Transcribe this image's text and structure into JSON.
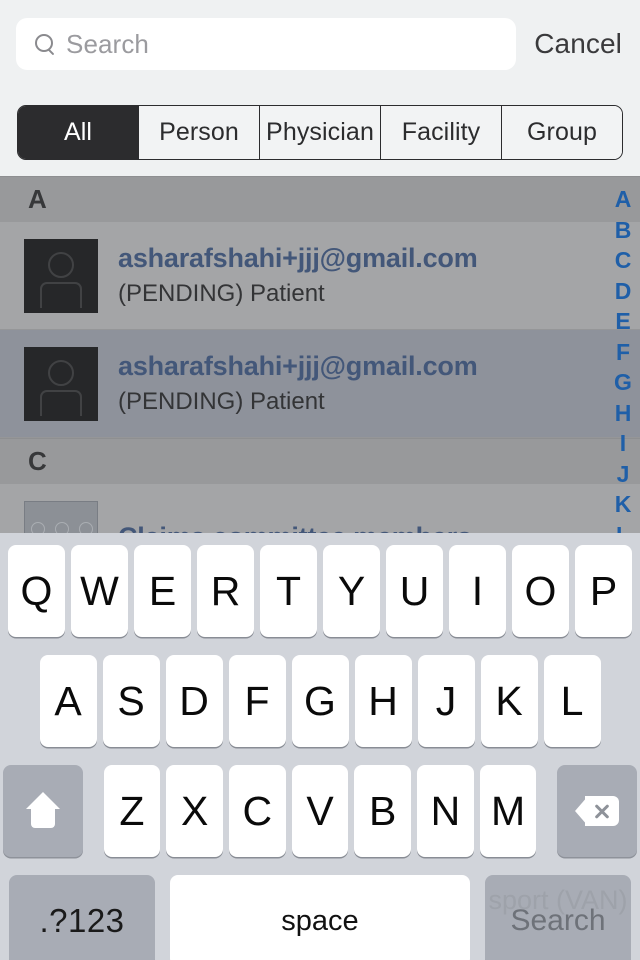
{
  "search": {
    "placeholder": "Search",
    "value": "",
    "icon": "search-icon",
    "cancel_label": "Cancel"
  },
  "filters": {
    "selected": "All",
    "options": [
      "All",
      "Person",
      "Physician",
      "Facility",
      "Group"
    ]
  },
  "list": {
    "sections": [
      {
        "letter": "A",
        "rows": [
          {
            "title": "asharafshahi+jjj@gmail.com",
            "subtitle": "(PENDING) Patient",
            "avatar": "person-avatar-icon",
            "selected": false
          },
          {
            "title": "asharafshahi+jjj@gmail.com",
            "subtitle": "(PENDING) Patient",
            "avatar": "person-avatar-icon",
            "selected": true
          }
        ]
      },
      {
        "letter": "C",
        "rows": [
          {
            "title": "Claims committee members",
            "subtitle": "",
            "avatar": "group-avatar-icon",
            "selected": false
          }
        ]
      }
    ]
  },
  "index_bar": {
    "letters": [
      "A",
      "B",
      "C",
      "D",
      "E",
      "F",
      "G",
      "H",
      "I",
      "J",
      "K",
      "L"
    ]
  },
  "keyboard": {
    "row1": [
      "Q",
      "W",
      "E",
      "R",
      "T",
      "Y",
      "U",
      "I",
      "O",
      "P"
    ],
    "row2": [
      "A",
      "S",
      "D",
      "F",
      "G",
      "H",
      "J",
      "K",
      "L"
    ],
    "row3": [
      "Z",
      "X",
      "C",
      "V",
      "B",
      "N",
      "M"
    ],
    "shift_icon": "shift-arrow-icon",
    "backspace_icon": "backspace-icon",
    "numbers_label": ".?123",
    "space_label": "space",
    "return_label": "Search",
    "ghost_text": "sport (VAN)"
  },
  "colors": {
    "accent_link": "#2D4A7A",
    "index_blue": "#1F5FA8",
    "segment_active_bg": "#2C2C2E",
    "keyboard_bg": "#D1D4DA",
    "chrome_bg": "#EFF1F2"
  }
}
